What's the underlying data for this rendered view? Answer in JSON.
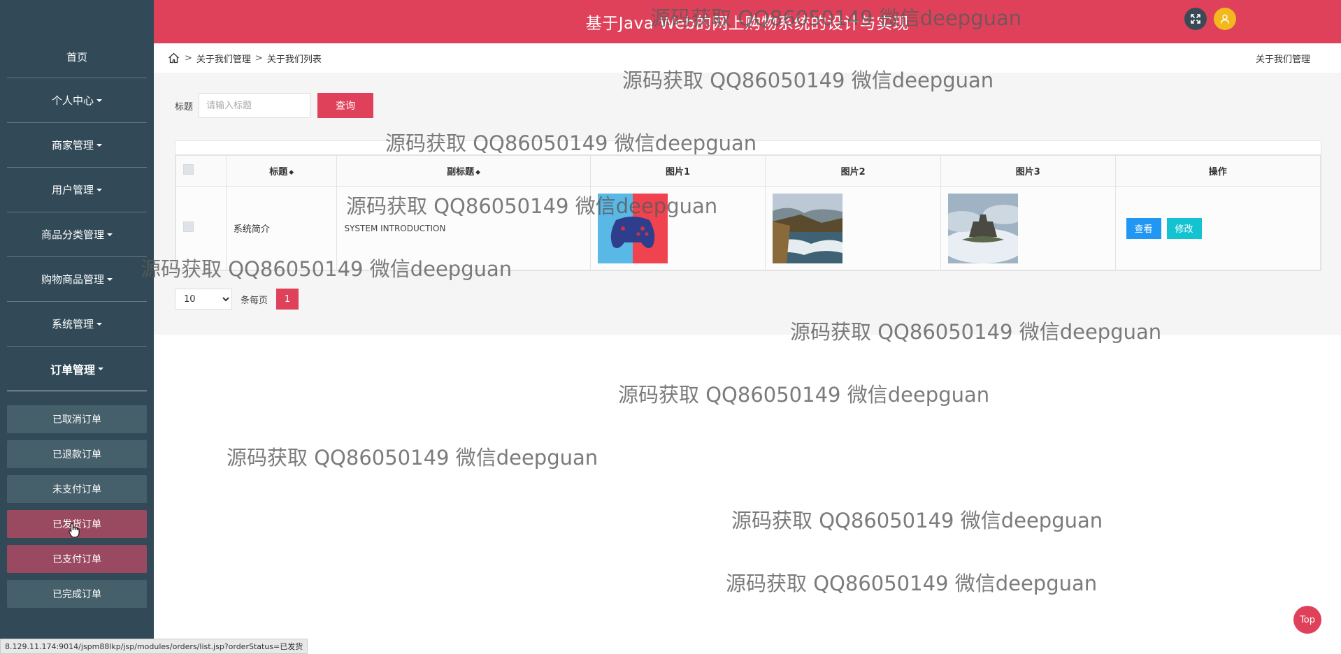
{
  "header": {
    "title": "基于Java Web的网上购物系统的设计与实现"
  },
  "sidebar": {
    "items": [
      {
        "label": "首页"
      },
      {
        "label": "个人中心"
      },
      {
        "label": "商家管理"
      },
      {
        "label": "用户管理"
      },
      {
        "label": "商品分类管理"
      },
      {
        "label": "购物商品管理"
      },
      {
        "label": "系统管理"
      },
      {
        "label": "订单管理"
      }
    ],
    "submenu": [
      {
        "label": "已取消订单"
      },
      {
        "label": "已退款订单"
      },
      {
        "label": "未支付订单"
      },
      {
        "label": "已发货订单"
      },
      {
        "label": "已支付订单"
      },
      {
        "label": "已完成订单"
      }
    ]
  },
  "breadcrumb": {
    "level1": "关于我们管理",
    "level2": "关于我们列表",
    "sep": ">",
    "right": "关于我们管理"
  },
  "search": {
    "label": "标题",
    "placeholder": "请输入标题",
    "button": "查询"
  },
  "table": {
    "headers": [
      "标题",
      "副标题",
      "图片1",
      "图片2",
      "图片3",
      "操作"
    ],
    "rows": [
      {
        "title": "系统简介",
        "subtitle": "SYSTEM INTRODUCTION",
        "images": [
          "gamepad-image",
          "coast-waves-image",
          "castle-clouds-image"
        ],
        "view_label": "查看",
        "edit_label": "修改"
      }
    ]
  },
  "pager": {
    "page_size": "10",
    "per_page_label": "条每页",
    "current_page": "1"
  },
  "watermark": "源码获取 QQ86050149 微信deepguan",
  "statusbar": "8.129.11.174:9014/jspm88lkp/jsp/modules/orders/list.jsp?orderStatus=已发货",
  "top_button": "Top",
  "colors": {
    "primary": "#e0415a",
    "sidebar": "#324a57",
    "view_button": "#2196f3",
    "edit_button": "#14c3d1",
    "user_avatar": "#f2b81c"
  }
}
